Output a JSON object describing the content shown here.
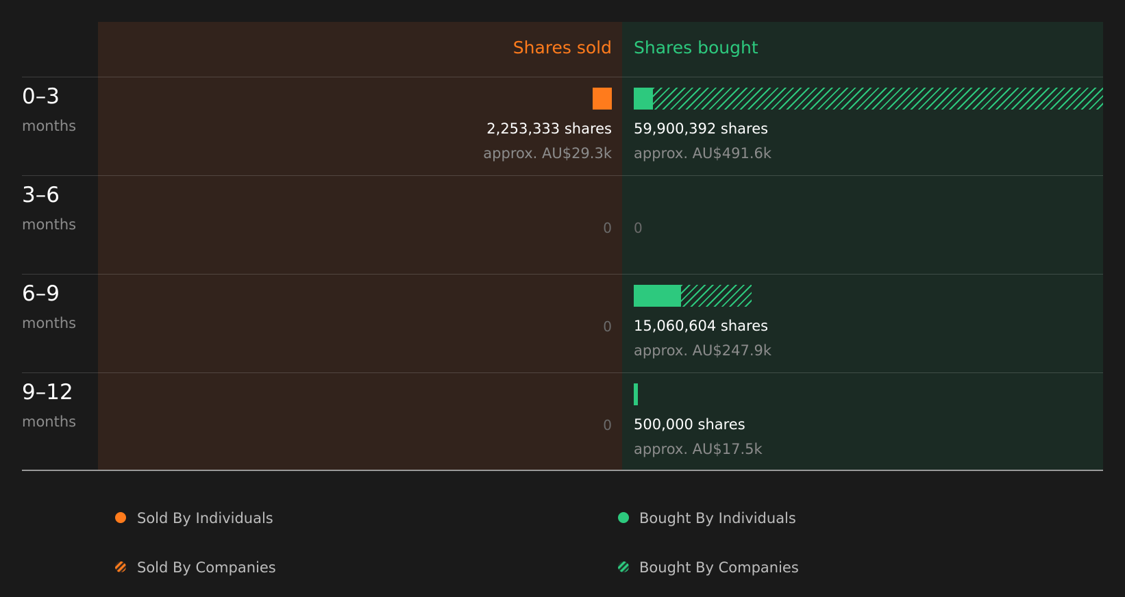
{
  "colors": {
    "background": "#1a1a1a",
    "sold": "#ff7b1c",
    "bought": "#2dc97e",
    "sold_panel": "#32231c",
    "bought_panel": "#1b2b24"
  },
  "headers": {
    "sold": "Shares sold",
    "bought": "Shares bought"
  },
  "rows": [
    {
      "period": "0–3",
      "unit": "months",
      "sold": {
        "shares": "2,253,333 shares",
        "approx": "approx. AU$29.3k"
      },
      "bought": {
        "shares": "59,900,392 shares",
        "approx": "approx. AU$491.6k"
      }
    },
    {
      "period": "3–6",
      "unit": "months",
      "sold_zero": "0",
      "bought_zero": "0"
    },
    {
      "period": "6–9",
      "unit": "months",
      "sold_zero": "0",
      "bought": {
        "shares": "15,060,604 shares",
        "approx": "approx. AU$247.9k"
      }
    },
    {
      "period": "9–12",
      "unit": "months",
      "sold_zero": "0",
      "bought": {
        "shares": "500,000 shares",
        "approx": "approx. AU$17.5k"
      }
    }
  ],
  "legend": {
    "sold_individuals": "Sold By Individuals",
    "sold_companies": "Sold By Companies",
    "bought_individuals": "Bought By Individuals",
    "bought_companies": "Bought By Companies"
  },
  "chart_data": {
    "type": "bar",
    "categories": [
      "0–3 months",
      "3–6 months",
      "6–9 months",
      "9–12 months"
    ],
    "axis_max_shares": 59900392,
    "series": [
      {
        "name": "Sold By Individuals",
        "values": [
          2253333,
          0,
          0,
          0
        ]
      },
      {
        "name": "Sold By Companies",
        "values": [
          0,
          0,
          0,
          0
        ]
      },
      {
        "name": "Bought By Individuals",
        "values": [
          2253333,
          0,
          6015000,
          500000
        ]
      },
      {
        "name": "Bought By Companies",
        "values": [
          57647059,
          0,
          9045604,
          0
        ]
      }
    ]
  }
}
